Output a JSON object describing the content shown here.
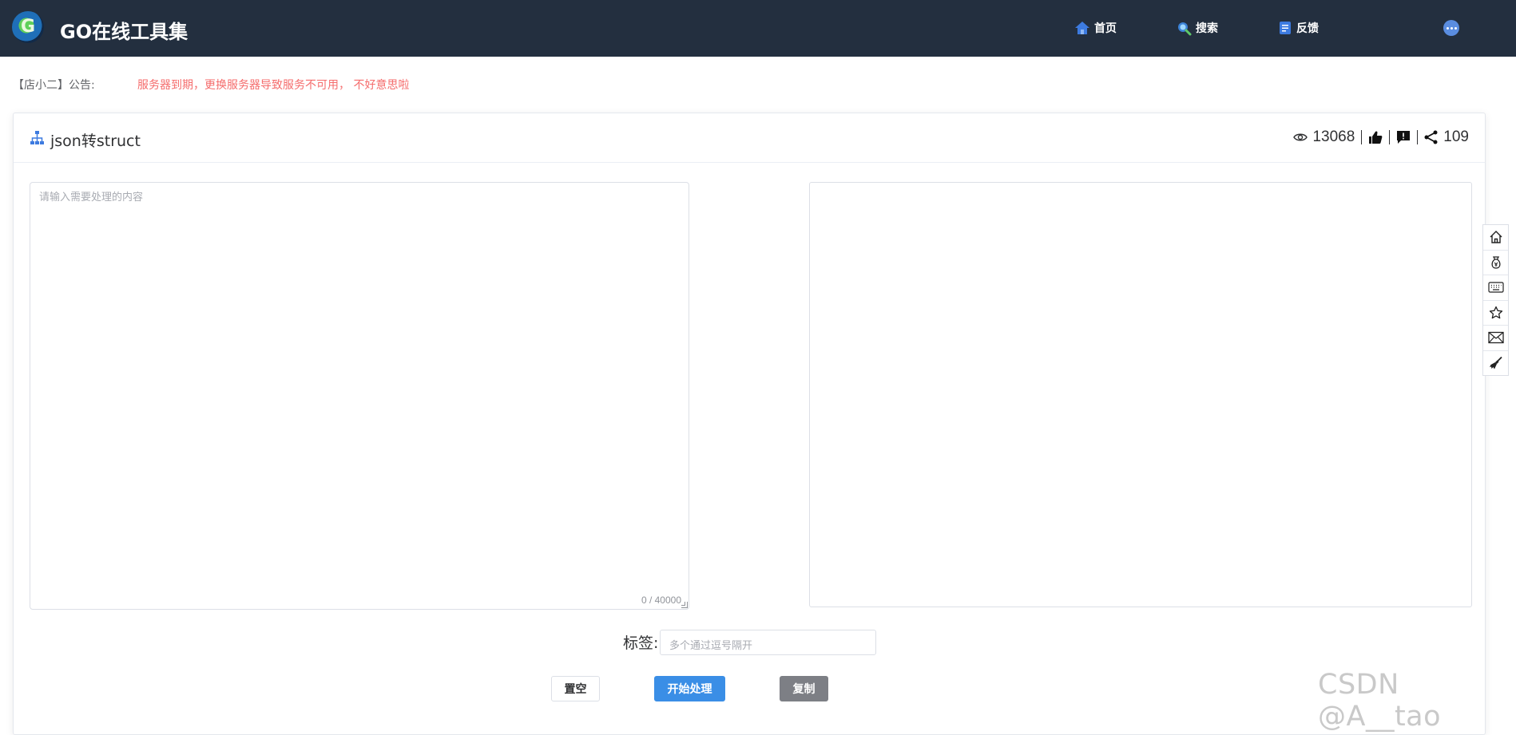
{
  "header": {
    "app_title": "GO在线工具集",
    "logo_letter": "G",
    "nav": [
      {
        "label": "首页",
        "icon": "home-icon"
      },
      {
        "label": "搜索",
        "icon": "search-icon"
      },
      {
        "label": "反馈",
        "icon": "feedback-icon"
      }
    ],
    "more_icon": "more-icon"
  },
  "notice": {
    "label": "【店小二】公告:",
    "text": "服务器到期，更换服务器导致服务不可用， 不好意思啦"
  },
  "tool": {
    "title": "json转struct",
    "icon": "sitemap-icon",
    "views": "13068",
    "shares": "109"
  },
  "input": {
    "placeholder": "请输入需要处理的内容",
    "counter": "0 / 40000"
  },
  "tags": {
    "label": "标签:",
    "placeholder": "多个通过逗号隔开"
  },
  "buttons": {
    "clear": "置空",
    "start": "开始处理",
    "copy": "复制"
  },
  "side_toolbar": [
    "home-icon",
    "money-bag-icon",
    "keyboard-icon",
    "star-icon",
    "mail-icon",
    "broom-icon"
  ],
  "watermark": "CSDN @A__tao",
  "colors": {
    "topbar": "#232f3f",
    "primary": "#3a8ee6",
    "notice": "#f56c6c",
    "copy_button": "#7d7f85"
  }
}
